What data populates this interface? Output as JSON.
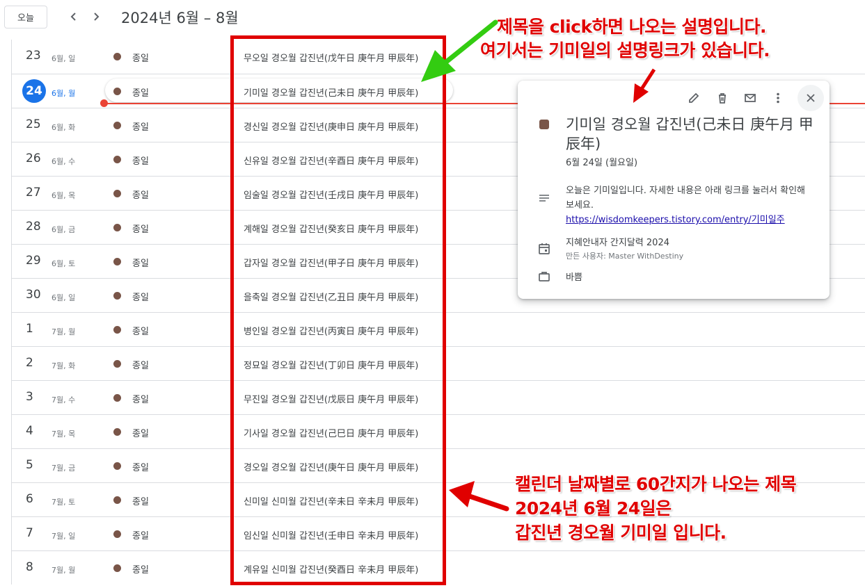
{
  "header": {
    "today_label": "오늘",
    "prev_icon": "chevron-left-icon",
    "next_icon": "chevron-right-icon",
    "date_range": "2024년 6월 – 8월"
  },
  "agenda": {
    "allday_label": "종일",
    "event_color": "#795548",
    "rows": [
      {
        "day": "23",
        "sub": "6월, 일",
        "title": "무오일 경오월 갑진년(戊午日 庚午月 甲辰年)"
      },
      {
        "day": "24",
        "sub": "6월, 월",
        "title": "기미일 경오월 갑진년(己未日 庚午月 甲辰年)",
        "today": true
      },
      {
        "day": "25",
        "sub": "6월, 화",
        "title": "경신일 경오월 갑진년(庚申日 庚午月 甲辰年)"
      },
      {
        "day": "26",
        "sub": "6월, 수",
        "title": "신유일 경오월 갑진년(辛酉日 庚午月 甲辰年)"
      },
      {
        "day": "27",
        "sub": "6월, 목",
        "title": "임술일 경오월 갑진년(壬戌日 庚午月 甲辰年)"
      },
      {
        "day": "28",
        "sub": "6월, 금",
        "title": "계해일 경오월 갑진년(癸亥日 庚午月 甲辰年)"
      },
      {
        "day": "29",
        "sub": "6월, 토",
        "title": "갑자일 경오월 갑진년(甲子日 庚午月 甲辰年)"
      },
      {
        "day": "30",
        "sub": "6월, 일",
        "title": "을축일 경오월 갑진년(乙丑日 庚午月 甲辰年)"
      },
      {
        "day": "1",
        "sub": "7월, 월",
        "title": "병인일 경오월 갑진년(丙寅日 庚午月 甲辰年)"
      },
      {
        "day": "2",
        "sub": "7월, 화",
        "title": "정묘일 경오월 갑진년(丁卯日 庚午月 甲辰年)"
      },
      {
        "day": "3",
        "sub": "7월, 수",
        "title": "무진일 경오월 갑진년(戊辰日 庚午月 甲辰年)"
      },
      {
        "day": "4",
        "sub": "7월, 목",
        "title": "기사일 경오월 갑진년(己巳日 庚午月 甲辰年)"
      },
      {
        "day": "5",
        "sub": "7월, 금",
        "title": "경오일 경오월 갑진년(庚午日 庚午月 甲辰年)"
      },
      {
        "day": "6",
        "sub": "7월, 토",
        "title": "신미일 신미월 갑진년(辛未日 辛未月 甲辰年)"
      },
      {
        "day": "7",
        "sub": "7월, 일",
        "title": "임신일 신미월 갑진년(壬申日 辛未月 甲辰年)"
      },
      {
        "day": "8",
        "sub": "7월, 월",
        "title": "계유일 신미월 갑진년(癸酉日 辛未月 甲辰年)"
      }
    ]
  },
  "popup": {
    "title": "기미일 경오월 갑진년(己未日 庚午月 甲辰年)",
    "date": "6월 24일 (월요일)",
    "description": "오늘은 기미일입니다. 자세한 내용은 아래 링크를 눌러서 확인해 보세요.",
    "link": "https://wisdomkeepers.tistory.com/entry/기미일주",
    "calendar_name": "지혜안내자 간지달력 2024",
    "owner": "만든 사용자: Master WithDestiny",
    "status": "바쁨",
    "icons": [
      "edit-icon",
      "delete-icon",
      "email-icon",
      "more-icon",
      "close-icon"
    ]
  },
  "annotations": {
    "top_line1": "제목을 click하면 나오는 설명입니다.",
    "top_line2": "여기서는 기미일의 설명링크가 있습니다.",
    "bottom_line1": "캘린더 날짜별로 60간지가 나오는 제목",
    "bottom_line2": "2024년 6월 24일은",
    "bottom_line3": "갑진년 경오월 기미일 입니다.",
    "colors": {
      "text": "#e00000",
      "green_arrow": "#33cc11",
      "red_arrow": "#e00000"
    }
  }
}
